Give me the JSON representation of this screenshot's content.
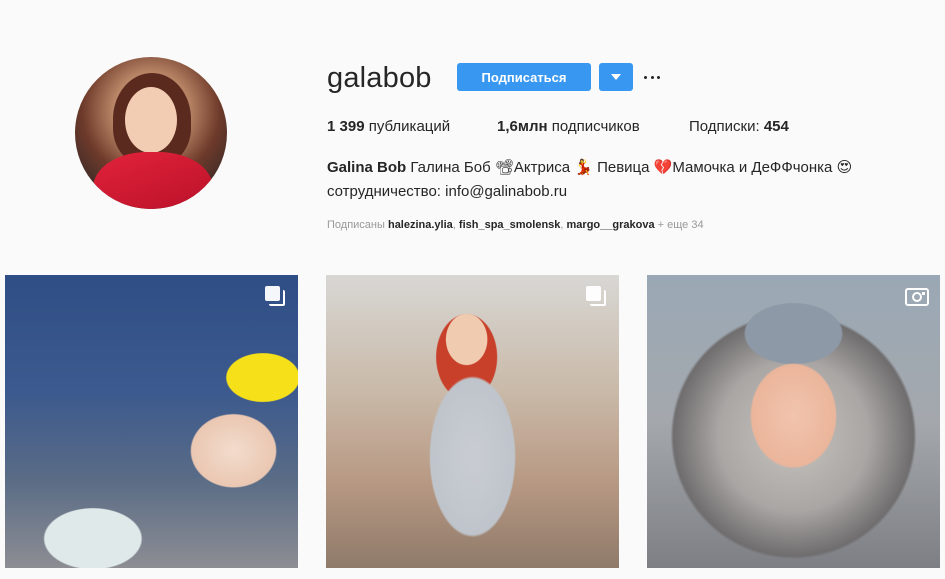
{
  "profile": {
    "username": "galabob",
    "follow_label": "Подписаться",
    "more_icon": "ellipsis-icon",
    "dropdown_icon": "caret-down-icon"
  },
  "stats": {
    "posts_count": "1 399",
    "posts_label": "публикаций",
    "followers_count": "1,6млн",
    "followers_label": "подписчиков",
    "following_label": "Подписки:",
    "following_count": "454"
  },
  "bio": {
    "full_name": "Galina Bob",
    "line1": "Галина Боб 📽Актриса 💃 Певица 💔Мамочка и ДеФФчонка 😍",
    "line2": "сотрудничество: info@galinabob.ru"
  },
  "followed_by": {
    "prefix": "Подписаны",
    "accounts": [
      "halezina.ylia",
      "fish_spa_smolensk",
      "margo__grakova"
    ],
    "more": "+ еще 34"
  },
  "posts": [
    {
      "type": "carousel",
      "icon": "multiple-images-icon"
    },
    {
      "type": "carousel",
      "icon": "multiple-images-icon"
    },
    {
      "type": "video",
      "icon": "video-camera-icon"
    }
  ]
}
